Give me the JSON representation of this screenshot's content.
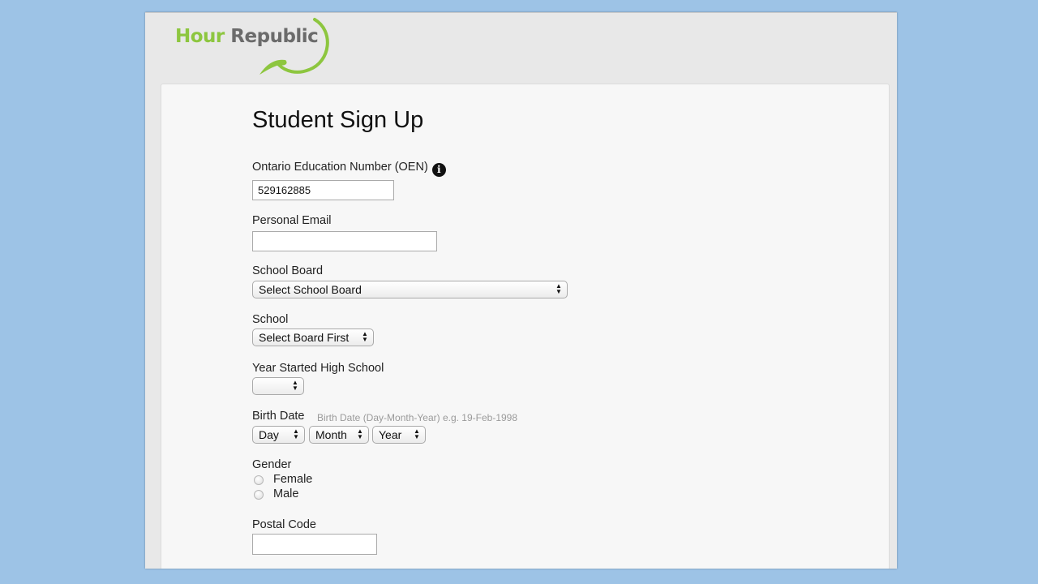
{
  "brand": {
    "logo_word1": "Hour",
    "logo_word2": "Republic",
    "primary_color": "#8dc63f",
    "secondary_color": "#6b6b6b"
  },
  "form": {
    "title": "Student Sign Up",
    "oen": {
      "label": "Ontario Education Number (OEN)",
      "value": "529162885",
      "info_icon": "i"
    },
    "email": {
      "label": "Personal Email",
      "value": ""
    },
    "school_board": {
      "label": "School Board",
      "selected": "Select School Board"
    },
    "school": {
      "label": "School",
      "selected": "Select Board First"
    },
    "year_started": {
      "label": "Year Started High School",
      "selected": ""
    },
    "birth_date": {
      "label": "Birth Date",
      "hint": "Birth Date (Day-Month-Year) e.g. 19-Feb-1998",
      "day": "Day",
      "month": "Month",
      "year": "Year"
    },
    "gender": {
      "label": "Gender",
      "options": [
        "Female",
        "Male"
      ],
      "selected": null
    },
    "postal_code": {
      "label": "Postal Code",
      "value": ""
    }
  },
  "icons": {
    "select_arrows_up": "▲",
    "select_arrows_down": "▼"
  }
}
